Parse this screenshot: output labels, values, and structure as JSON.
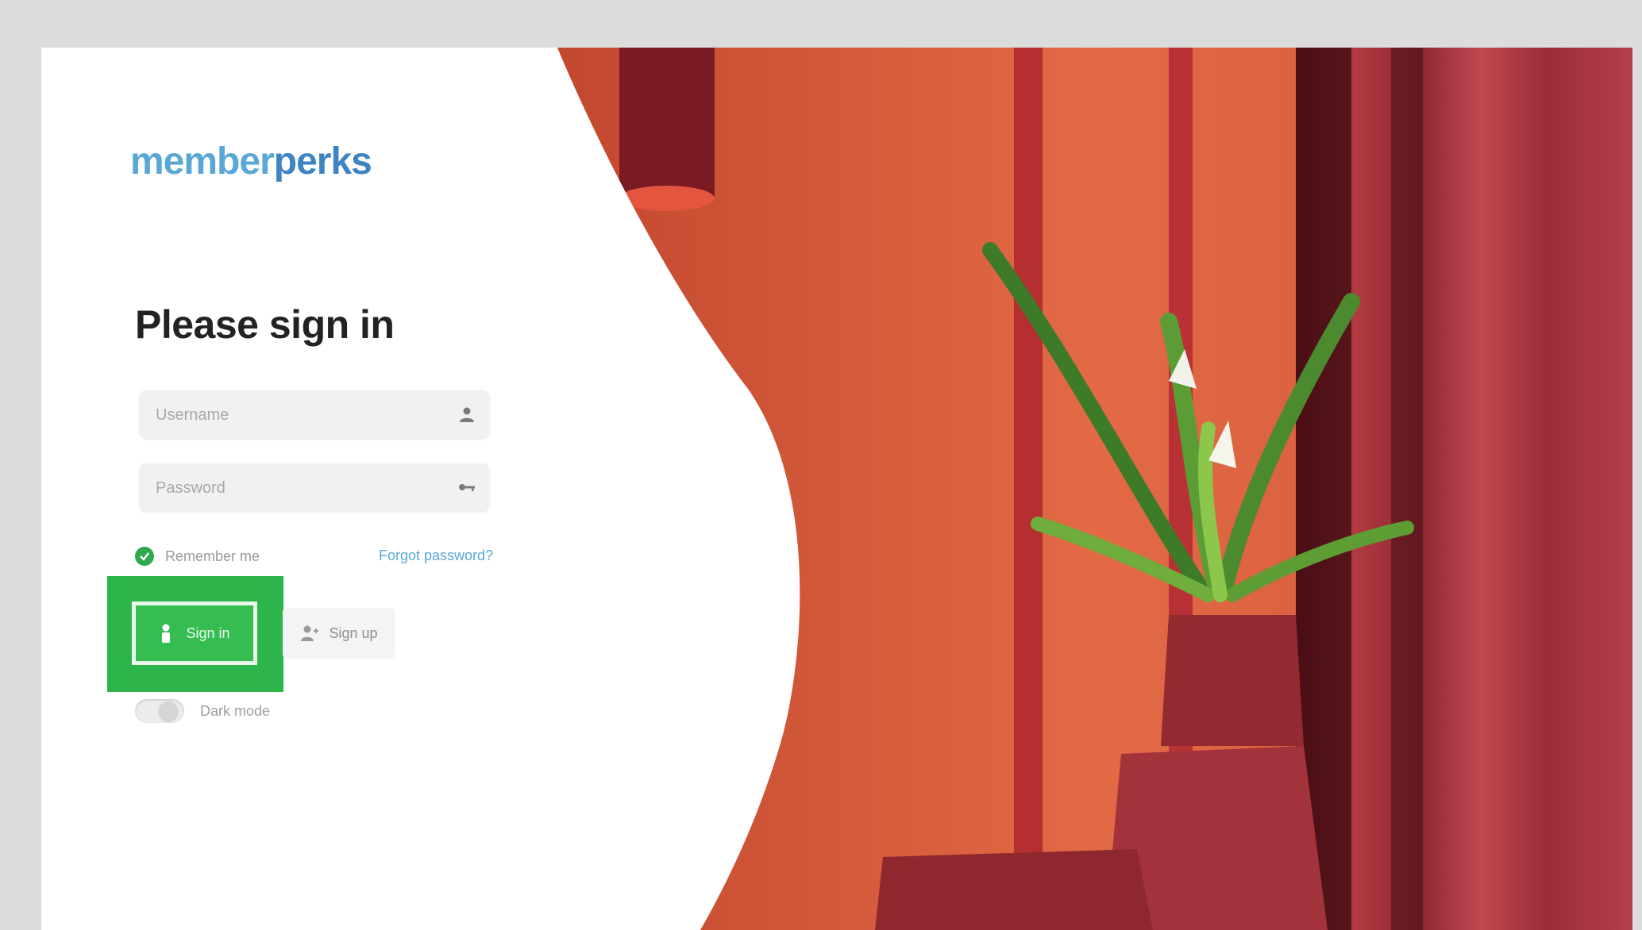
{
  "brand": {
    "logo_part1": "member",
    "logo_part2": "perks"
  },
  "login": {
    "title": "Please sign in",
    "username_placeholder": "Username",
    "password_placeholder": "Password",
    "remember_label": "Remember me",
    "forgot_label": "Forgot password?",
    "signin_label": "Sign in",
    "signup_label": "Sign up",
    "toggle_label": "Dark mode"
  },
  "icons": {
    "username": "user-icon",
    "password": "key-icon",
    "remember": "check-icon",
    "signin": "person-icon",
    "signup": "person-add-icon"
  },
  "colors": {
    "accent_blue": "#5aa7d6",
    "highlight_green": "#2db44a",
    "wall": "#d9593b",
    "curtain": "#a8303a"
  }
}
